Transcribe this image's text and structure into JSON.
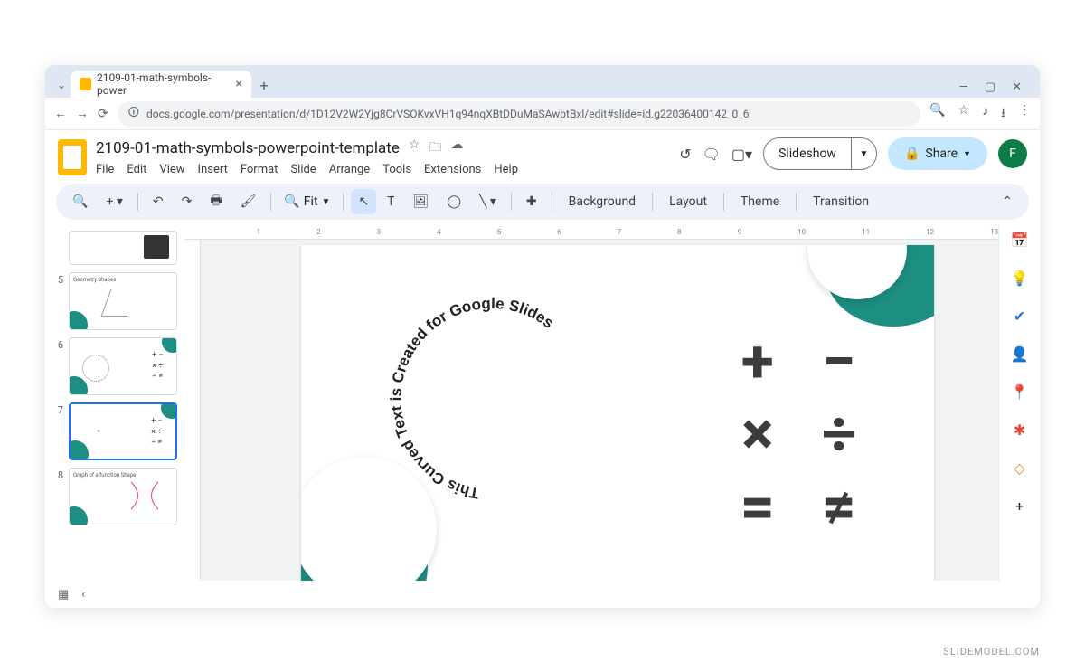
{
  "browser": {
    "tab_title": "2109-01-math-symbols-power",
    "url": "docs.google.com/presentation/d/1D12V2W2Yjg8CrVSOKvxVH1q94nqXBtDDuMaSAwbtBxl/edit#slide=id.g22036400142_0_6"
  },
  "doc": {
    "title": "2109-01-math-symbols-powerpoint-template",
    "avatar_letter": "F"
  },
  "menus": [
    "File",
    "Edit",
    "View",
    "Insert",
    "Format",
    "Slide",
    "Arrange",
    "Tools",
    "Extensions",
    "Help"
  ],
  "toolbar": {
    "zoom_label": "Fit",
    "buttons": [
      "Background",
      "Layout",
      "Theme",
      "Transition"
    ]
  },
  "header_buttons": {
    "slideshow": "Slideshow",
    "share": "Share"
  },
  "ruler_ticks": [
    "1",
    "2",
    "3",
    "4",
    "5",
    "6",
    "7",
    "8",
    "9",
    "10",
    "11",
    "12",
    "13"
  ],
  "thumbs": [
    {
      "n": "",
      "label": ""
    },
    {
      "n": "5",
      "label": "Geometry Shapes"
    },
    {
      "n": "6",
      "label": ""
    },
    {
      "n": "7",
      "label": "",
      "selected": true
    },
    {
      "n": "8",
      "label": "Graph of a function Shape"
    }
  ],
  "slide": {
    "curved_text": "This Curved Text is Created for Google Slides",
    "symbols": [
      "+",
      "−",
      "×",
      "÷",
      "=",
      "≠"
    ]
  },
  "watermark": "SLIDEMODEL.COM"
}
